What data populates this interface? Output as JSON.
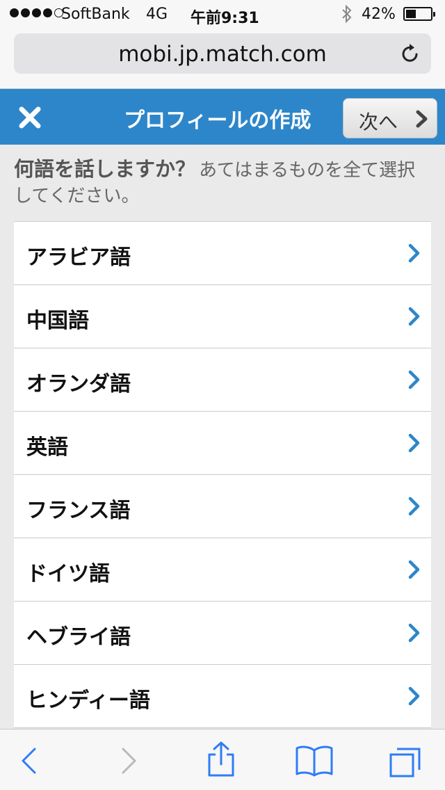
{
  "status_bar": {
    "carrier": "SoftBank",
    "network": "4G",
    "time": "午前9:31",
    "bluetooth_icon": "bluetooth-icon",
    "battery_percent": "42%",
    "battery_level": 0.42
  },
  "browser": {
    "url": "mobi.jp.match.com",
    "reload_icon": "reload-icon"
  },
  "header": {
    "close_icon": "close-icon",
    "title": "プロフィールの作成",
    "next_label": "次へ",
    "next_icon": "chevron-right-icon"
  },
  "question": {
    "title": "何語を話しますか？",
    "hint": "あてはまるものを全て選択してください。"
  },
  "languages": [
    {
      "label": "アラビア語"
    },
    {
      "label": "中国語"
    },
    {
      "label": "オランダ語"
    },
    {
      "label": "英語"
    },
    {
      "label": "フランス語"
    },
    {
      "label": "ドイツ語"
    },
    {
      "label": "ヘブライ語"
    },
    {
      "label": "ヒンディー語"
    }
  ],
  "colors": {
    "header_blue": "#2d86c9",
    "chevron_blue": "#2d86c9",
    "toolbar_blue": "#2f7cf6"
  },
  "toolbar": {
    "back_icon": "back-icon",
    "forward_icon": "forward-icon",
    "share_icon": "share-icon",
    "bookmarks_icon": "bookmarks-icon",
    "tabs_icon": "tabs-icon"
  }
}
